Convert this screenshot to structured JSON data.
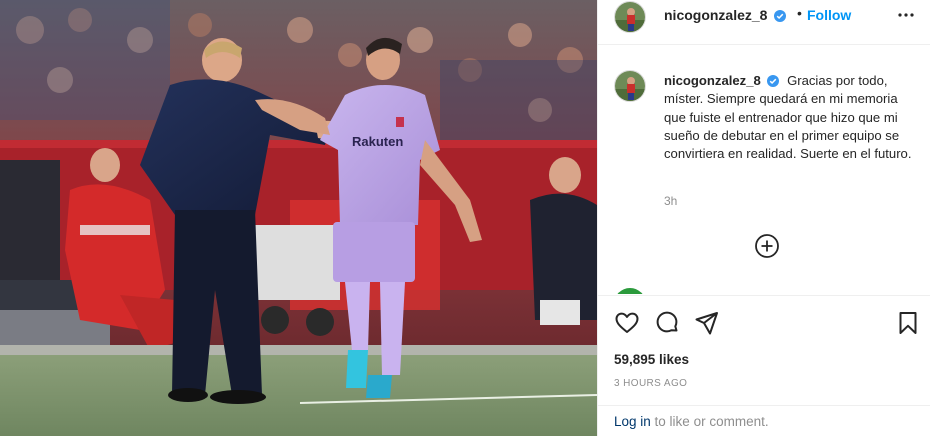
{
  "post": {
    "username": "nicogonzalez_8",
    "follow_label": "Follow",
    "separator": "•",
    "caption": {
      "username": "nicogonzalez_8",
      "text": "Gracias por todo, míster. Siempre quedará en mi memoria que fuiste el entrenador que hizo que mi sueño de debutar en el primer equipo se convirtiera en realidad. Suerte en el futuro."
    },
    "time_ago": "3h",
    "likes": "59,895 likes",
    "date": "3 HOURS AGO",
    "login": {
      "link": "Log in",
      "rest": " to like or comment."
    }
  },
  "photo": {
    "shirt_text": "Rakuten"
  },
  "icons": {
    "verified": "verified-badge-icon",
    "more": "more-options-icon",
    "load_more": "plus-circle-icon",
    "like": "heart-icon",
    "comment": "comment-bubble-icon",
    "share": "paper-plane-icon",
    "save": "bookmark-icon"
  },
  "colors": {
    "accent": "#0095f6",
    "link": "#00376b",
    "verified": "#3897f0",
    "muted": "#8e8e8e"
  }
}
